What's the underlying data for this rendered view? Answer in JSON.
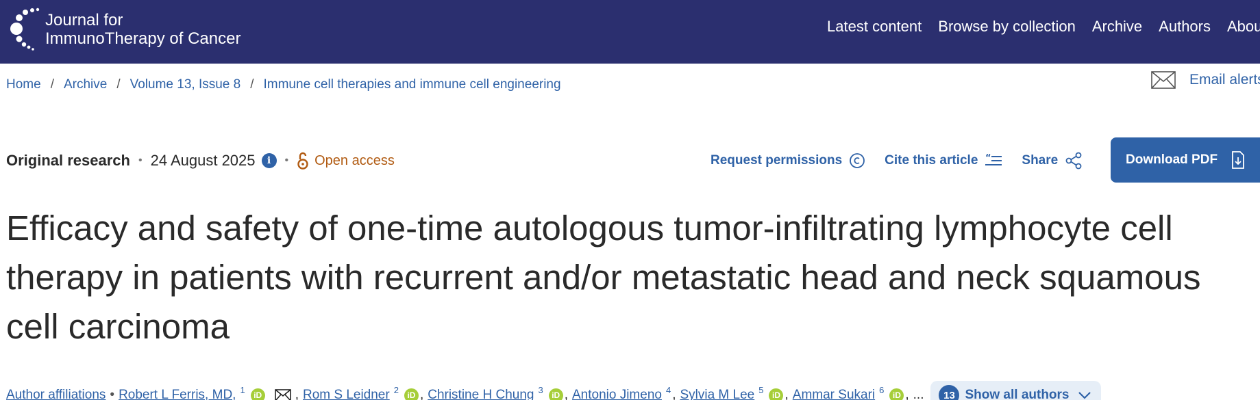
{
  "header": {
    "brand_line1": "Journal for",
    "brand_line2": "ImmunoTherapy of Cancer",
    "nav": [
      "Latest content",
      "Browse by collection",
      "Archive",
      "Authors",
      "About"
    ]
  },
  "breadcrumb": [
    "Home",
    "Archive",
    "Volume 13, Issue 8",
    "Immune cell therapies and immune cell engineering"
  ],
  "email_alerts": "Email alerts",
  "meta": {
    "type": "Original research",
    "date": "24 August 2025",
    "info_icon": "i",
    "access": "Open access"
  },
  "actions": {
    "permissions": "Request permissions",
    "cite": "Cite this article",
    "share": "Share",
    "download": "Download PDF"
  },
  "article": {
    "title": "Efficacy and safety of one-time autologous tumor-infiltrating lymphocyte cell therapy in patients with recurrent and/or metastatic head and neck squamous cell carcinoma"
  },
  "authors": {
    "affiliations_link": "Author affiliations",
    "list": [
      {
        "name": "Robert L Ferris, MD,",
        "sup": "1"
      },
      {
        "name": "Rom S Leidner",
        "sup": "2"
      },
      {
        "name": "Christine H Chung",
        "sup": "3"
      },
      {
        "name": "Antonio Jimeno",
        "sup": "4"
      },
      {
        "name": "Sylvia M Lee",
        "sup": "5"
      },
      {
        "name": "Ammar Sukari",
        "sup": "6"
      }
    ],
    "orcid_label": "iD",
    "ellipsis": "...",
    "show_all_count": "13",
    "show_all_label": "Show all authors"
  },
  "colors": {
    "header_bg": "#2b2f6f",
    "link": "#2f62a7",
    "open_access": "#b15b12",
    "orcid": "#a6ce39"
  }
}
